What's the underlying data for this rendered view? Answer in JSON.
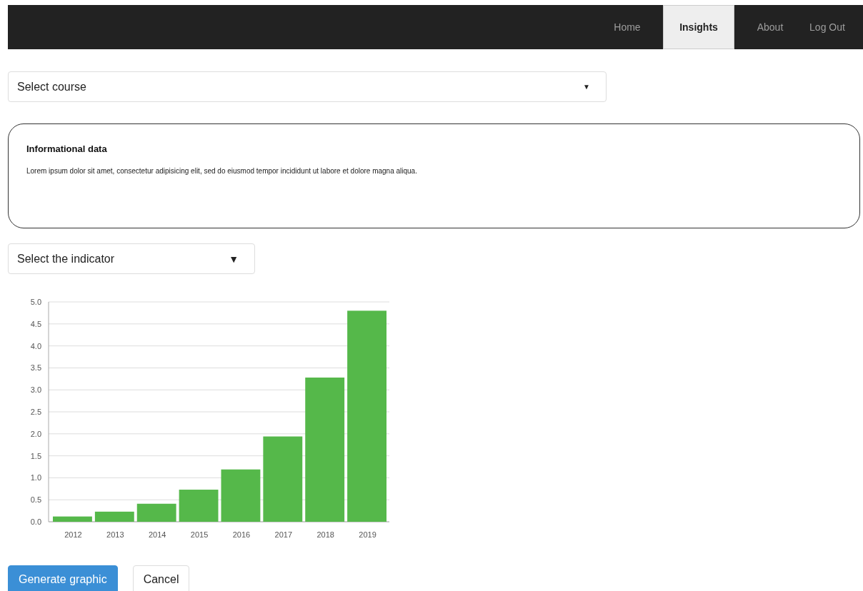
{
  "nav": {
    "items": [
      {
        "label": "Home",
        "selected": false
      },
      {
        "label": "Insights",
        "selected": true
      },
      {
        "label": "About",
        "selected": false
      },
      {
        "label": "Log Out",
        "selected": false
      }
    ]
  },
  "course_select": {
    "value": "Select course",
    "caret": "▼"
  },
  "info": {
    "title": "Informational data",
    "text": "Lorem ipsum dolor sit amet, consectetur adipisicing elit, sed do eiusmod tempor incididunt ut labore et dolore magna aliqua."
  },
  "indicator_select": {
    "value": "Select the indicator",
    "caret": "▼"
  },
  "chart": {
    "chart_data": {
      "type": "bar",
      "categories": [
        "2012",
        "2013",
        "2014",
        "2015",
        "2016",
        "2017",
        "2018",
        "2019"
      ],
      "grid": true,
      "series": [
        {
          "color": "#55b84a",
          "values": [
            0.12,
            0.23,
            0.41,
            0.73,
            1.19,
            1.94,
            3.28,
            4.8
          ]
        }
      ],
      "ylim": [
        0,
        5
      ],
      "yticks": [
        {
          "value": 0,
          "label": "0.0"
        },
        {
          "value": 0.5,
          "label": "0.5"
        },
        {
          "value": 1,
          "label": "1.0"
        },
        {
          "value": 1.5,
          "label": "1.5"
        },
        {
          "value": 2,
          "label": "2.0"
        },
        {
          "value": 2.5,
          "label": "2.5"
        },
        {
          "value": 3,
          "label": "3.0"
        },
        {
          "value": 3.5,
          "label": "3.5"
        },
        {
          "value": 4,
          "label": "4.0"
        },
        {
          "value": 4.5,
          "label": "4.5"
        },
        {
          "value": 5,
          "label": "5.0"
        }
      ]
    }
  },
  "buttons": [
    {
      "label": "Generate graphic",
      "kind": "primary"
    },
    {
      "label": "Cancel",
      "kind": "default"
    }
  ]
}
